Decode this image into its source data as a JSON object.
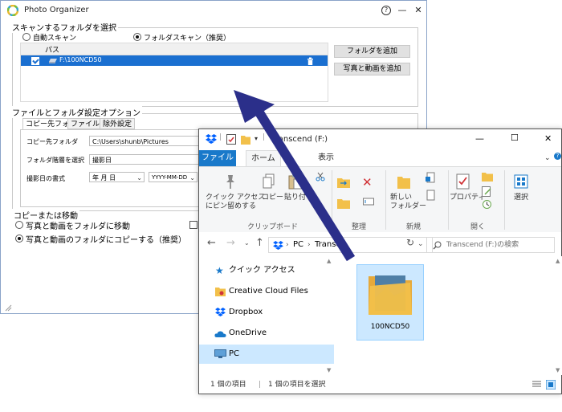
{
  "photo_organizer": {
    "title": "Photo Organizer",
    "help_label": "?",
    "minimize_label": "—",
    "close_label": "✕",
    "scan_section": {
      "legend": "スキャンするフォルダを選択",
      "radio_auto": "自動スキャン",
      "radio_folder": "フォルダスキャン（推奨）",
      "selected": "folder",
      "list_header": "パス",
      "rows": [
        {
          "path": "F:\\100NCD50",
          "checked": true
        }
      ],
      "add_folder_button": "フォルダを追加",
      "add_media_button": "写真と動画を追加"
    },
    "options_section": {
      "legend": "ファイルとフォルダ設定オプション",
      "tabs": [
        "コピー先フォルダ",
        "ファイル名",
        "除外設定"
      ],
      "active_tab": 0,
      "dest_label": "コピー先フォルダ",
      "dest_value": "C:\\Users\\shunb\\Pictures",
      "hierarchy_label": "フォルダ階層を選択",
      "hierarchy_value": "撮影日",
      "date_format_label": "撮影日の書式",
      "date_order_value": "年 月 日",
      "date_format_value": "YYYY-MM-DD"
    },
    "copy_move_section": {
      "legend": "コピーまたは移動",
      "radio_move": "写真と動画をフォルダに移動",
      "radio_copy": "写真と動画のフォルダにコピーする（推奨）",
      "selected": "copy"
    }
  },
  "explorer": {
    "title": "Transcend (F:)",
    "minimize_label": "—",
    "maximize_label": "☐",
    "close_label": "✕",
    "tabs": {
      "file": "ファイル",
      "home": "ホーム",
      "view": "表示"
    },
    "ribbon": {
      "pin_label_1": "クイック アクセス",
      "pin_label_2": "にピン留めする",
      "copy_label": "コピー",
      "paste_label": "貼り付",
      "clipboard_group": "クリップボード",
      "organize_group": "整理",
      "new_folder_label_1": "新しい",
      "new_folder_label_2": "フォルダー",
      "new_group": "新規",
      "properties_label": "プロパティ",
      "open_group": "開く",
      "select_label": "選択"
    },
    "address": {
      "pc": "PC",
      "drive": "Transc"
    },
    "search_placeholder": "Transcend (F:)の検索",
    "nav_items": [
      "クイック アクセス",
      "Creative Cloud Files",
      "Dropbox",
      "OneDrive",
      "PC"
    ],
    "selected_nav": 4,
    "folder_name": "100NCD50",
    "status_count": "1 個の項目",
    "status_selected": "1 個の項目を選択",
    "colors": {
      "accent": "#1979ca",
      "folder": "#f2c04a",
      "arrow": "#2b2f8a"
    }
  }
}
